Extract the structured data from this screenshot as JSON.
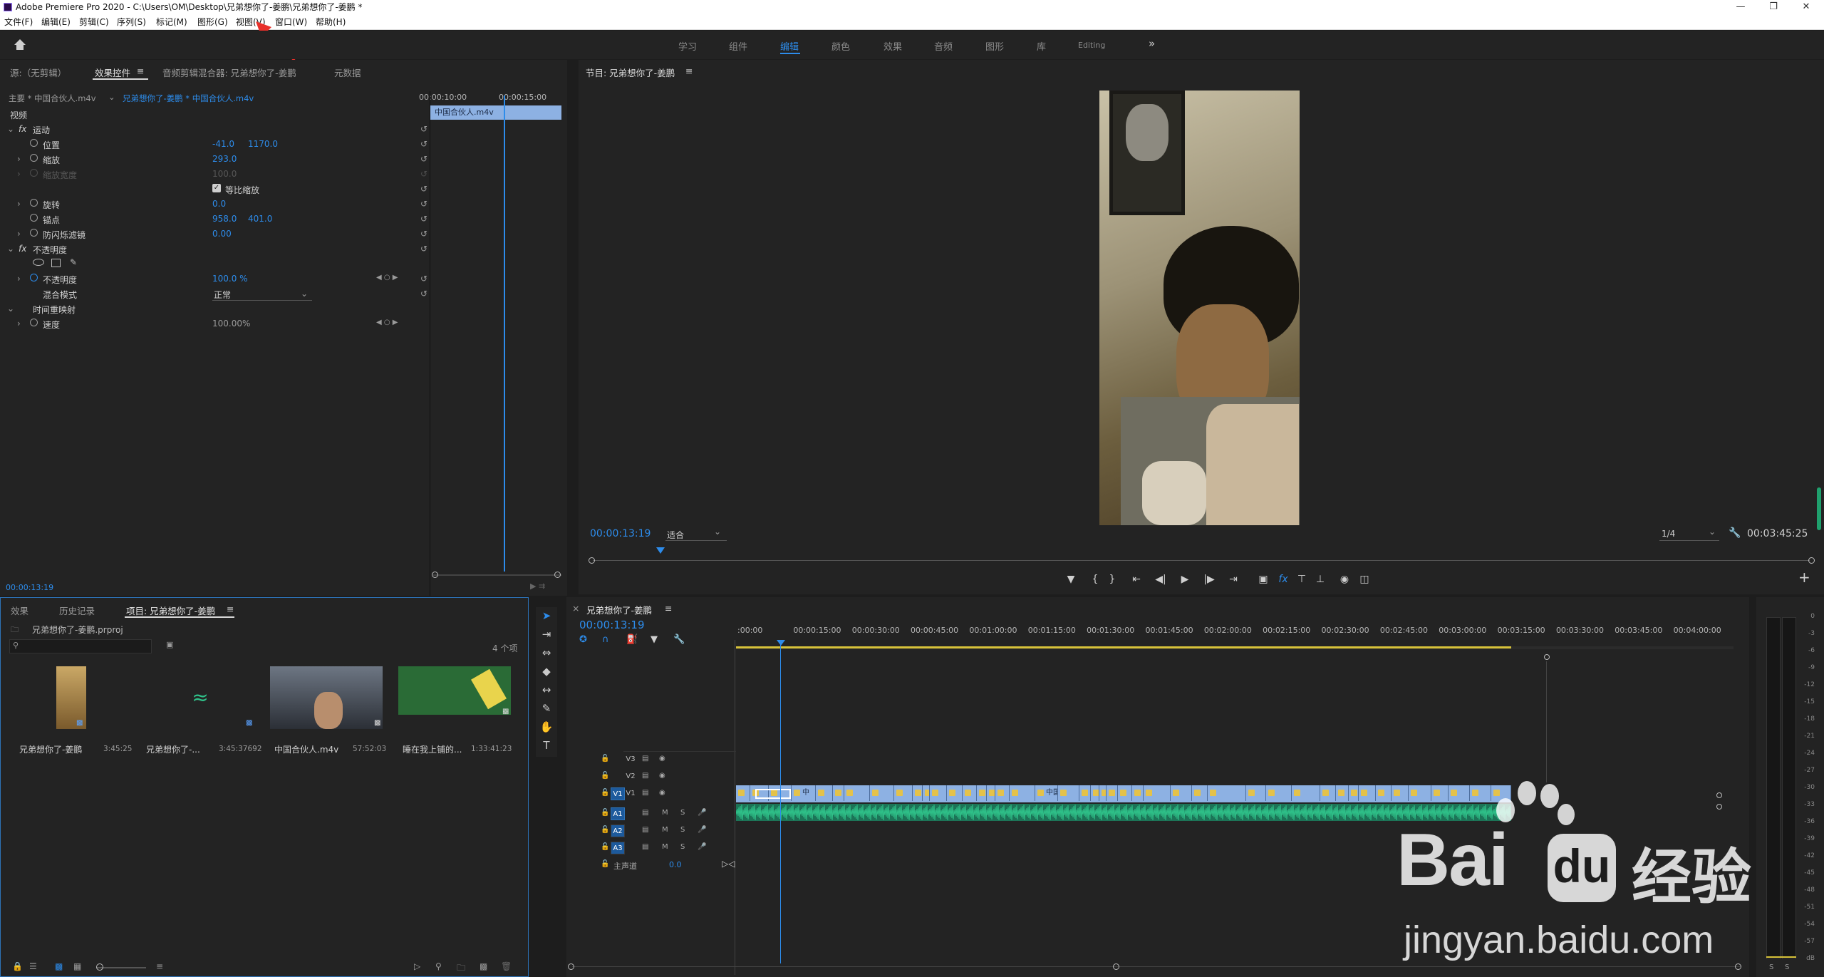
{
  "window": {
    "title": "Adobe Premiere Pro 2020 - C:\\Users\\OM\\Desktop\\兄弟想你了-姜鹏\\兄弟想你了-姜鹏 *"
  },
  "menu": [
    "文件(F)",
    "编辑(E)",
    "剪辑(C)",
    "序列(S)",
    "标记(M)",
    "图形(G)",
    "视图(V)",
    "窗口(W)",
    "帮助(H)"
  ],
  "workspaces": [
    "学习",
    "组件",
    "编辑",
    "颜色",
    "效果",
    "音频",
    "图形",
    "库",
    "Editing"
  ],
  "active_workspace": "编辑",
  "ws_more": "»",
  "source_tabs": {
    "source": "源:（无剪辑）",
    "effect_controls": "效果控件",
    "audio_mixer": "音频剪辑混合器: 兄弟想你了-姜鹏",
    "metadata": "元数据"
  },
  "effect_controls": {
    "master": "主要 * 中国合伙人.m4v",
    "sequence_clip": "兄弟想你了-姜鹏 * 中国合伙人.m4v",
    "time_start": "00:00:10:00",
    "time_end": "00:00:15:00",
    "clip_name": "中国合伙人.m4v",
    "video_label": "视频",
    "motion": "运动",
    "position_label": "位置",
    "position_x": "-41.0",
    "position_y": "1170.0",
    "scale_label": "缩放",
    "scale": "293.0",
    "scale_width_label": "缩放宽度",
    "scale_width": "100.0",
    "uniform_scale_label": "等比缩放",
    "rotation_label": "旋转",
    "rotation": "0.0",
    "anchor_label": "锚点",
    "anchor_x": "958.0",
    "anchor_y": "401.0",
    "flicker_label": "防闪烁滤镜",
    "flicker": "0.00",
    "opacity_group": "不透明度",
    "opacity_label": "不透明度",
    "opacity": "100.0 %",
    "blend_label": "混合模式",
    "blend": "正常",
    "time_remap": "时间重映射",
    "speed_label": "速度",
    "speed": "100.00%",
    "current_time": "00:00:13:19",
    "fx_glyph": "fx"
  },
  "program": {
    "title": "节目: 兄弟想你了-姜鹏",
    "timecode": "00:00:13:19",
    "fit": "适合",
    "resolution": "1/4",
    "duration": "00:03:45:25"
  },
  "project": {
    "tabs": [
      "效果",
      "历史记录",
      "项目: 兄弟想你了-姜鹏"
    ],
    "file": "兄弟想你了-姜鹏.prproj",
    "count": "4 个项",
    "search_placeholder": "",
    "items": [
      {
        "name": "兄弟想你了-姜鹏",
        "dur": "3:45:25"
      },
      {
        "name": "兄弟想你了-...",
        "dur": "3:45:37692"
      },
      {
        "name": "中国合伙人.m4v",
        "dur": "57:52:03"
      },
      {
        "name": "睡在我上铺的...",
        "dur": "1:33:41:23"
      }
    ]
  },
  "timeline": {
    "title": "兄弟想你了-姜鹏",
    "timecode": "00:00:13:19",
    "ticks": [
      ":00:00",
      "00:00:15:00",
      "00:00:30:00",
      "00:00:45:00",
      "00:01:00:00",
      "00:01:15:00",
      "00:01:30:00",
      "00:01:45:00",
      "00:02:00:00",
      "00:02:15:00",
      "00:02:30:00",
      "00:02:45:00",
      "00:03:00:00",
      "00:03:15:00",
      "00:03:30:00",
      "00:03:45:00",
      "00:04:00:00"
    ],
    "video_tracks": [
      "V3",
      "V2",
      "V1"
    ],
    "audio_tracks": [
      "A1",
      "A2",
      "A3"
    ],
    "m": "M",
    "s": "S",
    "master": "主声道",
    "master_val": "0.0",
    "clip_labels": [
      "中",
      "中国合伙人.m4v",
      "中国合伙人.m",
      "中国合伙",
      "中国合伙人.m4v",
      "中国合伙人.m4",
      "中国合伙人.m",
      "中国合伙人.m4v"
    ]
  },
  "vu": {
    "scale": [
      "0",
      "-3",
      "-6",
      "-9",
      "-12",
      "-15",
      "-18",
      "-21",
      "-24",
      "-27",
      "-30",
      "-33",
      "-36",
      "-39",
      "-42",
      "-45",
      "-48",
      "-51",
      "-54",
      "-57",
      "dB"
    ],
    "solo": "S"
  },
  "watermark": {
    "brand": "Bai",
    "du": "du",
    "cn": "经验",
    "url": "jingyan.baidu.com"
  },
  "colors": {
    "accent": "#2d8ceb",
    "clip": "#8db1e3",
    "audio": "#2fc189",
    "playhead": "#2d8ceb",
    "work_area": "#d7c23a"
  }
}
